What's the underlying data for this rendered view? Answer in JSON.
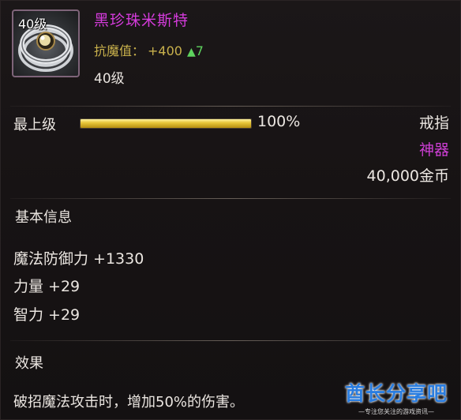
{
  "item": {
    "icon_level": "40级",
    "icon": "ring-icon",
    "name": "黑珍珠米斯特",
    "stat_label": "抗魔值：",
    "stat_value": "+400",
    "stat_delta": "7",
    "required_level": "40级"
  },
  "upgrade": {
    "label": "最上级",
    "progress": 1.0,
    "percent_text": "100%"
  },
  "meta": {
    "type": "戒指",
    "rarity": "神器",
    "price": "40,000金币"
  },
  "basic_info": {
    "title": "基本信息",
    "stats": [
      "魔法防御力 +1330",
      "力量 +29",
      "智力 +29"
    ]
  },
  "effect": {
    "title": "效果",
    "text": "破招魔法攻击时，增加50%的伤害。"
  },
  "watermark": {
    "main": "酋长分享吧",
    "sub": "—专注您关注的游戏资讯—"
  },
  "colors": {
    "name": "#d53bdc",
    "rarity": "#cf3fd6",
    "stat": "#c9b14c",
    "delta": "#5ed35e",
    "bar": "#e8c83a",
    "watermark": "#2a7de0"
  }
}
